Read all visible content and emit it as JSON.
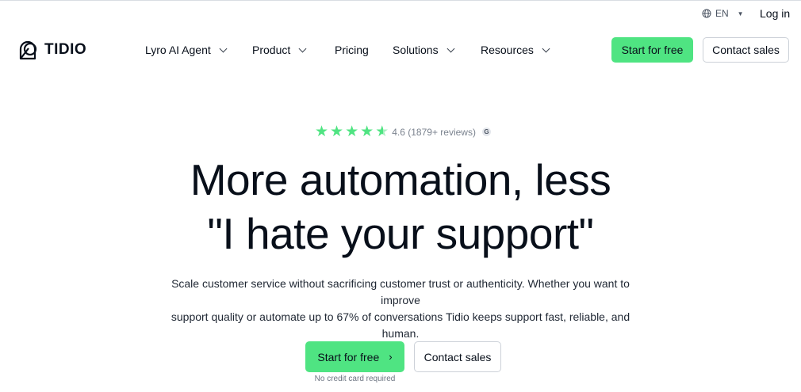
{
  "topbar": {
    "language": "EN",
    "login": "Log in"
  },
  "nav": {
    "logo_text": "TIDIO",
    "items": [
      {
        "label": "Lyro AI Agent",
        "has_dropdown": true
      },
      {
        "label": "Product",
        "has_dropdown": true
      },
      {
        "label": "Pricing",
        "has_dropdown": false
      },
      {
        "label": "Solutions",
        "has_dropdown": true
      },
      {
        "label": "Resources",
        "has_dropdown": true
      }
    ],
    "start_free": "Start for free",
    "contact_sales": "Contact sales"
  },
  "hero": {
    "rating": {
      "stars": 4.6,
      "text": "4.6 (1879+ reviews)",
      "badge_icon": "g2-icon"
    },
    "headline_line1": "More automation, less",
    "headline_line2": "\"I hate your support\"",
    "subtext_line1": "Scale customer service without sacrificing customer trust or authenticity. Whether you want to improve",
    "subtext_line2": "support quality or automate up to 67% of conversations Tidio keeps support fast, reliable, and human.",
    "cta_primary": "Start for free",
    "cta_primary_icon": "chevron-right-icon",
    "cta_secondary": "Contact sales",
    "note": "No credit card required"
  },
  "colors": {
    "accent": "#4fe482",
    "text": "#080f1a",
    "border": "#ccd1d8"
  }
}
